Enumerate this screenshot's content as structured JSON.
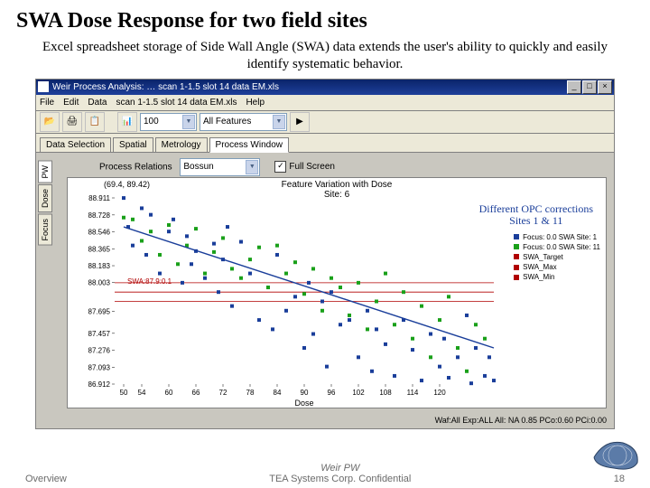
{
  "title": "SWA Dose Response for two field sites",
  "subtitle": "Excel spreadsheet storage of Side Wall Angle (SWA) data extends the user's ability to quickly and easily identify systematic behavior.",
  "window": {
    "title": "Weir Process Analysis: … scan 1-1.5 slot 14 data EM.xls",
    "min": "_",
    "max": "□",
    "close": "×",
    "menus": [
      "File",
      "Edit",
      "Data",
      "scan 1-1.5 slot 14 data EM.xls",
      "Help"
    ],
    "combo1": "100",
    "combo2": "All Features",
    "tabs": [
      "Data Selection",
      "Spatial",
      "Metrology",
      "Process Window"
    ],
    "activeTab": 3,
    "sidetabs": [
      "PW",
      "Dose",
      "Focus"
    ],
    "subpanel": {
      "lbl1": "Process Relations",
      "combo": "Bossun",
      "chk": "✓",
      "chklbl": "Full Screen"
    }
  },
  "opc": {
    "l1": "Different OPC corrections",
    "l2": "Sites 1 & 11"
  },
  "swa_label": "SWA:87.9:0.1",
  "chart": {
    "title1": "Feature Variation with Dose",
    "title2": "Site: 6",
    "coord": "(69.4, 89.42)",
    "xlabel": "Dose",
    "legend": [
      {
        "name": "Focus: 0.0 SWA Site: 1",
        "color": "#1a3e9a"
      },
      {
        "name": "Focus: 0.0 SWA Site: 11",
        "color": "#1aa01a"
      },
      {
        "name": "SWA_Target",
        "color": "#b00000"
      },
      {
        "name": "SWA_Max",
        "color": "#b00000"
      },
      {
        "name": "SWA_Min",
        "color": "#b00000"
      }
    ]
  },
  "chart_data": {
    "type": "scatter",
    "xlabel": "Dose",
    "ylabel": "",
    "xlim": [
      48,
      132
    ],
    "ylim": [
      86.912,
      88.911
    ],
    "yticks": [
      86.912,
      87.093,
      87.276,
      87.457,
      87.695,
      88.003,
      88.183,
      88.365,
      88.546,
      88.728,
      88.911
    ],
    "xticks": [
      50,
      54,
      60,
      66,
      72,
      78,
      84,
      90,
      96,
      102,
      108,
      114,
      120
    ],
    "swa_target": 87.9,
    "swa_max": 88.0,
    "swa_min": 87.8,
    "series": [
      {
        "name": "Focus: 0.0 SWA Site: 1",
        "color": "#1a3e9a",
        "points": [
          [
            50,
            88.91
          ],
          [
            51,
            88.6
          ],
          [
            52,
            88.4
          ],
          [
            54,
            88.8
          ],
          [
            55,
            88.3
          ],
          [
            56,
            88.73
          ],
          [
            58,
            88.1
          ],
          [
            60,
            88.55
          ],
          [
            61,
            88.68
          ],
          [
            63,
            88.0
          ],
          [
            64,
            88.5
          ],
          [
            65,
            88.2
          ],
          [
            66,
            88.34
          ],
          [
            68,
            88.05
          ],
          [
            70,
            88.42
          ],
          [
            71,
            87.9
          ],
          [
            72,
            88.25
          ],
          [
            73,
            88.6
          ],
          [
            74,
            87.75
          ],
          [
            76,
            88.44
          ],
          [
            78,
            88.1
          ],
          [
            80,
            87.6
          ],
          [
            82,
            87.95
          ],
          [
            83,
            87.5
          ],
          [
            84,
            88.3
          ],
          [
            86,
            87.7
          ],
          [
            88,
            87.85
          ],
          [
            90,
            87.3
          ],
          [
            91,
            88.0
          ],
          [
            92,
            87.45
          ],
          [
            94,
            87.8
          ],
          [
            95,
            87.1
          ],
          [
            96,
            87.9
          ],
          [
            98,
            87.55
          ],
          [
            100,
            87.6
          ],
          [
            102,
            87.2
          ],
          [
            104,
            87.7
          ],
          [
            105,
            87.05
          ],
          [
            106,
            87.5
          ],
          [
            108,
            87.34
          ],
          [
            110,
            87.0
          ],
          [
            112,
            87.6
          ],
          [
            114,
            87.28
          ],
          [
            116,
            86.95
          ],
          [
            118,
            87.45
          ],
          [
            120,
            87.1
          ],
          [
            121,
            87.4
          ],
          [
            122,
            86.98
          ],
          [
            124,
            87.2
          ],
          [
            126,
            87.65
          ],
          [
            127,
            86.92
          ],
          [
            128,
            87.3
          ],
          [
            130,
            87.0
          ],
          [
            131,
            87.2
          ],
          [
            132,
            86.95
          ]
        ]
      },
      {
        "name": "Focus: 0.0 SWA Site: 11",
        "color": "#1aa01a",
        "points": [
          [
            50,
            88.7
          ],
          [
            52,
            88.68
          ],
          [
            54,
            88.45
          ],
          [
            56,
            88.55
          ],
          [
            58,
            88.3
          ],
          [
            60,
            88.62
          ],
          [
            62,
            88.2
          ],
          [
            64,
            88.4
          ],
          [
            66,
            88.58
          ],
          [
            68,
            88.1
          ],
          [
            70,
            88.33
          ],
          [
            72,
            88.48
          ],
          [
            74,
            88.15
          ],
          [
            76,
            88.05
          ],
          [
            78,
            88.25
          ],
          [
            80,
            88.38
          ],
          [
            82,
            87.95
          ],
          [
            84,
            88.4
          ],
          [
            86,
            88.1
          ],
          [
            88,
            88.22
          ],
          [
            90,
            87.88
          ],
          [
            92,
            88.15
          ],
          [
            94,
            87.7
          ],
          [
            96,
            88.05
          ],
          [
            98,
            87.95
          ],
          [
            100,
            87.65
          ],
          [
            102,
            88.0
          ],
          [
            104,
            87.5
          ],
          [
            106,
            87.8
          ],
          [
            108,
            88.1
          ],
          [
            110,
            87.55
          ],
          [
            112,
            87.9
          ],
          [
            114,
            87.4
          ],
          [
            116,
            87.75
          ],
          [
            118,
            87.2
          ],
          [
            120,
            87.6
          ],
          [
            122,
            87.85
          ],
          [
            124,
            87.3
          ],
          [
            126,
            87.05
          ],
          [
            128,
            87.55
          ],
          [
            130,
            87.4
          ]
        ]
      }
    ],
    "trend": [
      [
        50,
        88.6
      ],
      [
        132,
        87.3
      ]
    ]
  },
  "waf": "Waf:All Exp:ALL All: NA 0.85 PCo:0.60 PCi:0.00",
  "footer": {
    "left": "Overview",
    "mid1": "Weir PW",
    "mid2": "TEA Systems Corp. Confidential",
    "right": "18"
  }
}
